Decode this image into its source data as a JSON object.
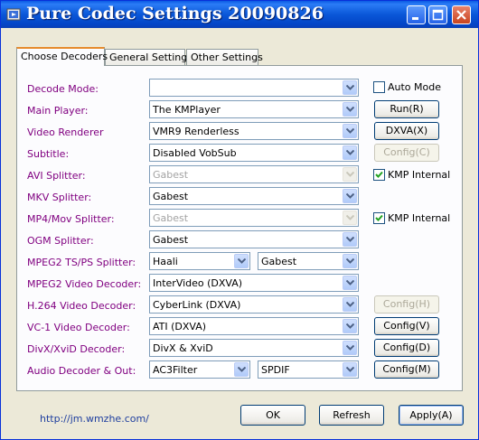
{
  "window": {
    "title": "Pure Codec Settings 20090826"
  },
  "tabs": [
    {
      "label": "Choose Decoders",
      "active": true
    },
    {
      "label": "General Settings",
      "active": false
    },
    {
      "label": "Other Settings",
      "active": false
    }
  ],
  "rows": {
    "decode_mode": {
      "label": "Decode Mode:",
      "value": ""
    },
    "main_player": {
      "label": "Main Player:",
      "value": "The KMPlayer"
    },
    "video_renderer": {
      "label": "Video Renderer",
      "value": "VMR9 Renderless"
    },
    "subtitle": {
      "label": "Subtitle:",
      "value": "Disabled VobSub"
    },
    "avi_splitter": {
      "label": "AVI Splitter:",
      "value": "Gabest",
      "disabled": true
    },
    "mkv_splitter": {
      "label": "MKV Splitter:",
      "value": "Gabest"
    },
    "mp4_splitter": {
      "label": "MP4/Mov Splitter:",
      "value": "Gabest",
      "disabled": true
    },
    "ogm_splitter": {
      "label": "OGM Splitter:",
      "value": "Gabest"
    },
    "mpeg2_ts_splitter": {
      "label": "MPEG2 TS/PS Splitter:",
      "value": "Haali",
      "value2": "Gabest"
    },
    "mpeg2_video": {
      "label": "MPEG2 Video Decoder:",
      "value": "InterVideo (DXVA)"
    },
    "h264_video": {
      "label": "H.264 Video Decoder:",
      "value": "CyberLink (DXVA)"
    },
    "vc1_video": {
      "label": "VC-1 Video Decoder:",
      "value": "ATI (DXVA)"
    },
    "divx_decoder": {
      "label": "DivX/XviD Decoder:",
      "value": "DivX & XviD"
    },
    "audio_decoder": {
      "label": "Audio Decoder & Out:",
      "value": "AC3Filter",
      "value2": "SPDIF"
    }
  },
  "side": {
    "auto_mode": {
      "label": "Auto Mode",
      "checked": false
    },
    "run_button": "Run(R)",
    "dxva_button": "DXVA(X)",
    "config_subtitle": "Config(C)",
    "avi_kmp_internal": {
      "label": "KMP Internal",
      "checked": true
    },
    "mp4_kmp_internal": {
      "label": "KMP Internal",
      "checked": true
    },
    "config_h264": "Config(H)",
    "config_vc1": "Config(V)",
    "config_divx": "Config(D)",
    "config_audio": "Config(M)"
  },
  "footer": {
    "link": "http://jm.wmzhe.com/",
    "ok": "OK",
    "refresh": "Refresh",
    "apply": "Apply(A)"
  },
  "icons": {
    "app": "codec-app-icon",
    "minimize": "minimize-icon",
    "maximize": "maximize-icon",
    "close": "close-icon",
    "dropdown": "chevron-down-icon",
    "check": "checkmark-icon"
  },
  "colors": {
    "title_bar": "#0a57d8",
    "label_text": "#800080",
    "tab_highlight": "#e68b2c",
    "link": "#1f3f9f"
  }
}
